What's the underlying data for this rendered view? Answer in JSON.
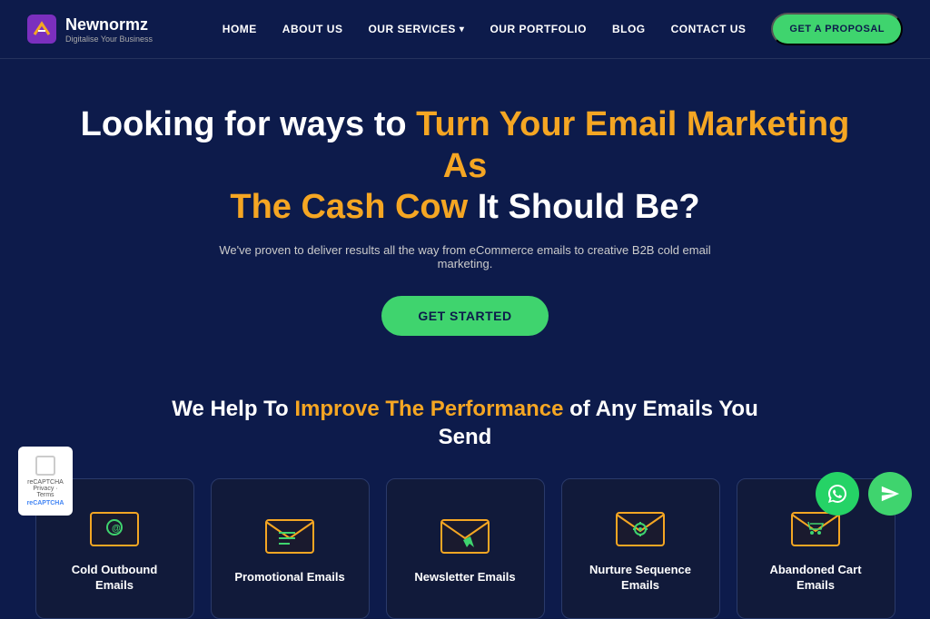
{
  "navbar": {
    "logo_name": "Newnormz",
    "logo_tagline": "Digitalise Your Business",
    "links": [
      {
        "label": "HOME",
        "id": "home"
      },
      {
        "label": "ABOUT US",
        "id": "about"
      },
      {
        "label": "OUR SERVICES",
        "id": "services",
        "has_dropdown": true
      },
      {
        "label": "OUR PORTFOLIO",
        "id": "portfolio"
      },
      {
        "label": "BLOG",
        "id": "blog"
      },
      {
        "label": "CONTACT US",
        "id": "contact"
      }
    ],
    "cta_label": "GET A PROPOSAL"
  },
  "hero": {
    "title_part1": "Looking for ways to ",
    "title_highlight": "Turn Your Email Marketing As The Cash Cow",
    "title_part2": " It Should Be?",
    "subtitle": "We've proven to deliver results all the way from eCommerce emails to creative B2B cold email marketing.",
    "cta_label": "GET STARTED"
  },
  "section": {
    "title_part1": "We Help To ",
    "title_highlight": "Improve The Performance",
    "title_part2": " of Any Emails You Send"
  },
  "cards": [
    {
      "id": "cold-outbound",
      "label": "Cold Outbound Emails",
      "icon_type": "at-envelope"
    },
    {
      "id": "promotional",
      "label": "Promotional Emails",
      "icon_type": "list-envelope"
    },
    {
      "id": "newsletter",
      "label": "Newsletter Emails",
      "icon_type": "cursor-envelope"
    },
    {
      "id": "nurture",
      "label": "Nurture Sequence Emails",
      "icon_type": "gear-envelope"
    },
    {
      "id": "abandoned-cart",
      "label": "Abandoned Cart Emails",
      "icon_type": "cart-envelope"
    }
  ],
  "chat_buttons": {
    "whatsapp_label": "💬",
    "send_label": "➤"
  },
  "captcha": {
    "label": "reCAPTCHA",
    "sub": "Privacy · Terms"
  }
}
